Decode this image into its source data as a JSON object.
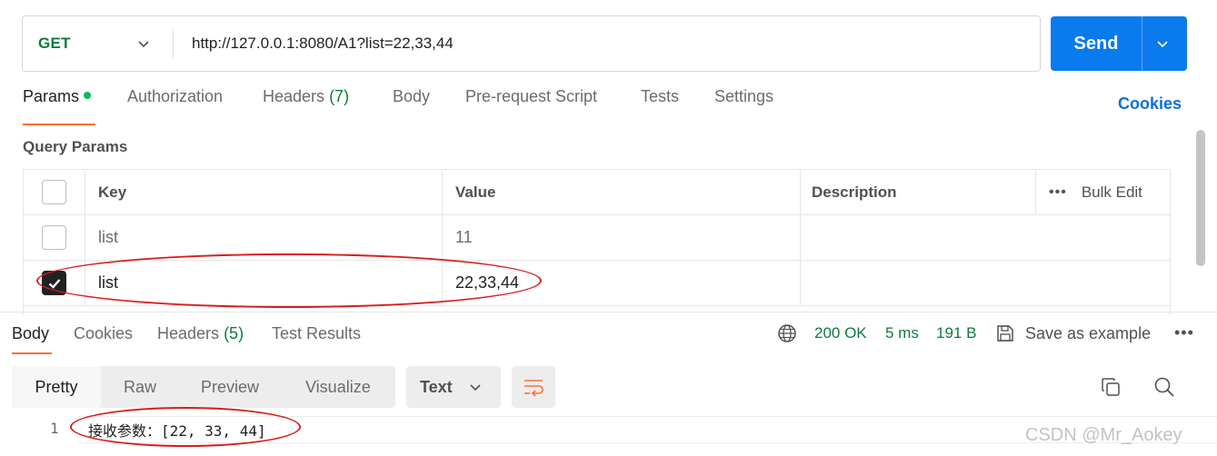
{
  "request": {
    "method": "GET",
    "url": "http://127.0.0.1:8080/A1?list=22,33,44",
    "send_label": "Send"
  },
  "request_tabs": [
    {
      "label": "Params",
      "active": true,
      "dot": true
    },
    {
      "label": "Authorization"
    },
    {
      "label": "Headers",
      "count": "(7)"
    },
    {
      "label": "Body"
    },
    {
      "label": "Pre-request Script"
    },
    {
      "label": "Tests"
    },
    {
      "label": "Settings"
    }
  ],
  "cookies_label": "Cookies",
  "query_params": {
    "title": "Query Params",
    "headers": {
      "key": "Key",
      "value": "Value",
      "description": "Description",
      "bulk_edit": "Bulk Edit",
      "more": "•••"
    },
    "rows": [
      {
        "checked": false,
        "key": "list",
        "value": "11",
        "description": ""
      },
      {
        "checked": true,
        "key": "list",
        "value": "22,33,44",
        "description": ""
      }
    ]
  },
  "response": {
    "tabs": [
      {
        "label": "Body",
        "active": true
      },
      {
        "label": "Cookies"
      },
      {
        "label": "Headers",
        "count": "(5)"
      },
      {
        "label": "Test Results"
      }
    ],
    "status": "200 OK",
    "time": "5 ms",
    "size": "191 B",
    "save_label": "Save as example",
    "more": "•••",
    "formats": [
      "Pretty",
      "Raw",
      "Preview",
      "Visualize"
    ],
    "active_format": "Pretty",
    "type": "Text",
    "lines": [
      {
        "number": "1",
        "text": "接收参数：[22, 33, 44]"
      }
    ]
  },
  "watermark": "CSDN @Mr_Aokey",
  "colors": {
    "accent": "#ff6c37",
    "send": "#097bed",
    "method": "#0f7a3d",
    "status": "#0f7a3d",
    "annotation": "#d91d1d"
  },
  "icons": [
    "chevron-down-icon",
    "globe-icon",
    "save-icon",
    "wrap-lines-icon",
    "copy-icon",
    "search-icon",
    "checkmark-icon"
  ]
}
